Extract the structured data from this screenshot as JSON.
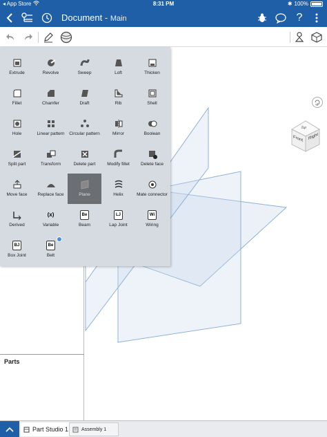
{
  "status_bar": {
    "back_app": "App Store",
    "time": "8:31 PM",
    "battery": "100%"
  },
  "nav": {
    "document_title": "Document",
    "separator": " - ",
    "workspace": "Main"
  },
  "feature_panel": {
    "items": [
      {
        "label": "Extrude",
        "icon": "extrude-icon"
      },
      {
        "label": "Revolve",
        "icon": "revolve-icon"
      },
      {
        "label": "Sweep",
        "icon": "sweep-icon"
      },
      {
        "label": "Loft",
        "icon": "loft-icon"
      },
      {
        "label": "Thicken",
        "icon": "thicken-icon"
      },
      {
        "label": "Fillet",
        "icon": "fillet-icon"
      },
      {
        "label": "Chamfer",
        "icon": "chamfer-icon"
      },
      {
        "label": "Draft",
        "icon": "draft-icon"
      },
      {
        "label": "Rib",
        "icon": "rib-icon"
      },
      {
        "label": "Shell",
        "icon": "shell-icon"
      },
      {
        "label": "Hole",
        "icon": "hole-icon"
      },
      {
        "label": "Linear pattern",
        "icon": "linear-pattern-icon"
      },
      {
        "label": "Circular pattern",
        "icon": "circular-pattern-icon"
      },
      {
        "label": "Mirror",
        "icon": "mirror-icon"
      },
      {
        "label": "Boolean",
        "icon": "boolean-icon"
      },
      {
        "label": "Split part",
        "icon": "split-part-icon"
      },
      {
        "label": "Transform",
        "icon": "transform-icon"
      },
      {
        "label": "Delete part",
        "icon": "delete-part-icon"
      },
      {
        "label": "Modify fillet",
        "icon": "modify-fillet-icon"
      },
      {
        "label": "Delete face",
        "icon": "delete-face-icon"
      },
      {
        "label": "Move face",
        "icon": "move-face-icon"
      },
      {
        "label": "Replace face",
        "icon": "replace-face-icon"
      },
      {
        "label": "Plane",
        "icon": "plane-icon"
      },
      {
        "label": "Helix",
        "icon": "helix-icon"
      },
      {
        "label": "Mate connector",
        "icon": "mate-connector-icon"
      },
      {
        "label": "Derived",
        "icon": "derived-icon"
      },
      {
        "label": "Variable",
        "icon": "variable-icon",
        "glyph": "(x)"
      },
      {
        "label": "Beam",
        "icon": "beam-icon",
        "glyph": "Be"
      },
      {
        "label": "Lap Joint",
        "icon": "lap-joint-icon",
        "glyph": "LJ"
      },
      {
        "label": "Wiring",
        "icon": "wiring-icon",
        "glyph": "Wi"
      },
      {
        "label": "Box Joint",
        "icon": "box-joint-icon",
        "glyph": "BJ"
      },
      {
        "label": "Belt",
        "icon": "belt-icon",
        "glyph": "Be"
      }
    ]
  },
  "viewcube": {
    "front": "Front",
    "right": "Right",
    "top": "Top"
  },
  "parts_panel": {
    "title": "Parts"
  },
  "tabs": [
    {
      "label": "Part Studio 1"
    },
    {
      "label": "Assembly 1"
    }
  ],
  "colors": {
    "header": "#1f5fa8",
    "panel": "#d6dbe2",
    "selected": "#6b6e72",
    "plane_stroke": "#8fb0d8"
  }
}
